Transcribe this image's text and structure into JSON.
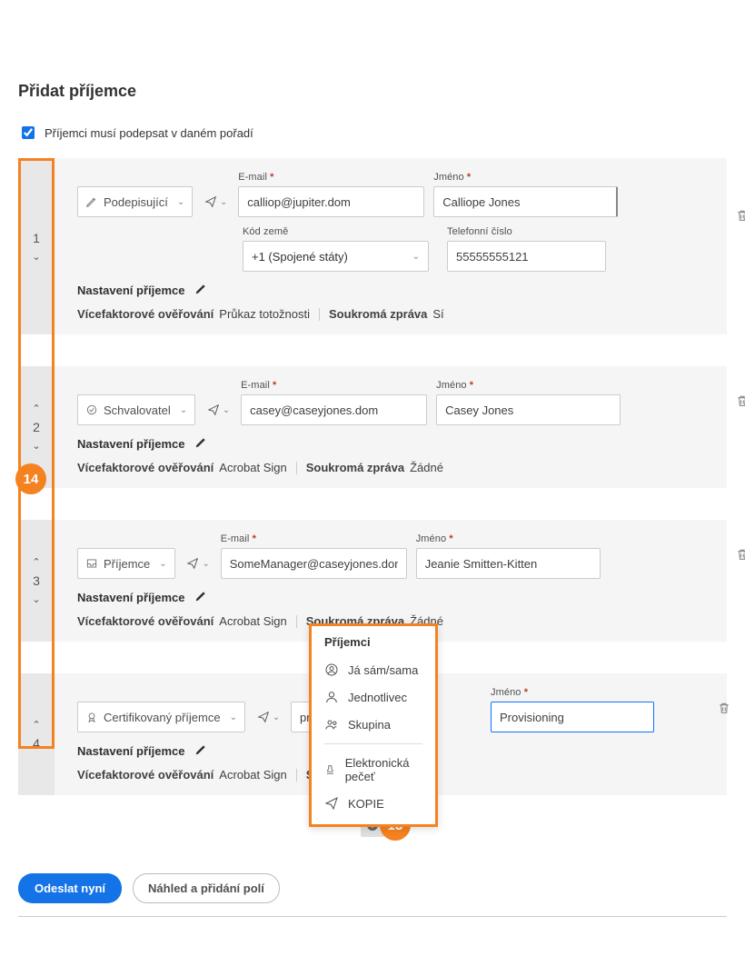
{
  "heading": "Přidat příjemce",
  "order_checkbox_label": "Příjemci musí podepsat v daném pořadí",
  "badge14": "14",
  "badge13": "13",
  "labels": {
    "email": "E-mail",
    "name": "Jméno",
    "country": "Kód země",
    "phone": "Telefonní číslo",
    "settings": "Nastavení příjemce",
    "mfa": "Vícefaktorové ověřování",
    "private_msg": "Soukromá zpráva"
  },
  "recipients": [
    {
      "order": "1",
      "role": "Podepisující",
      "email": "calliop@jupiter.dom",
      "name": "Calliope Jones",
      "country_code": "+1 (Spojené státy)",
      "phone": "55555555121",
      "mfa": "Průkaz totožnosti",
      "private_msg": "Sí"
    },
    {
      "order": "2",
      "role": "Schvalovatel",
      "email": "casey@caseyjones.dom",
      "name": "Casey Jones",
      "mfa": "Acrobat Sign",
      "private_msg": "Žádné"
    },
    {
      "order": "3",
      "role": "Příjemce",
      "email": "SomeManager@caseyjones.dom",
      "name": "Jeanie Smitten-Kitten",
      "mfa": "Acrobat Sign",
      "private_msg": "Žádné"
    },
    {
      "order": "4",
      "role": "Certifikovaný příjemce",
      "email": "provis",
      "name": "Provisioning",
      "mfa": "Acrobat Sign",
      "private_msg_prefix": "Soukrom"
    }
  ],
  "popup": {
    "title": "Příjemci",
    "items": [
      "Já sám/sama",
      "Jednotlivec",
      "Skupina"
    ],
    "items2": [
      "Elektronická pečeť",
      "KOPIE"
    ]
  },
  "buttons": {
    "send": "Odeslat nyní",
    "preview": "Náhled a přidání polí"
  }
}
